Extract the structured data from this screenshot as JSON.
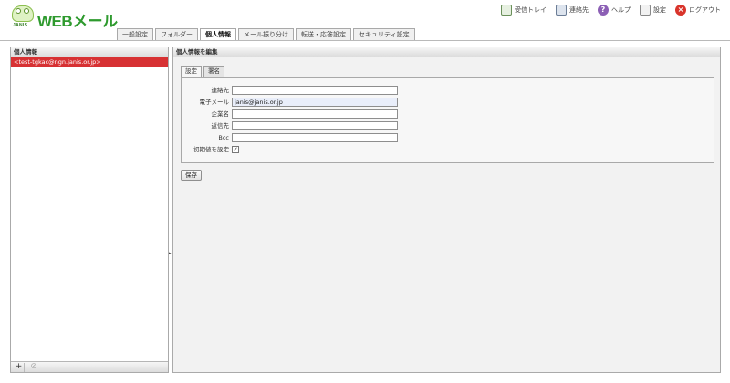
{
  "header": {
    "brand": "JANIS",
    "app_title": "WEBメール",
    "links": [
      {
        "icon": "inbox-tray-icon",
        "label": "受信トレイ"
      },
      {
        "icon": "address-book-icon",
        "label": "連絡先"
      },
      {
        "icon": "help-icon",
        "label": "ヘルプ"
      },
      {
        "icon": "settings-icon",
        "label": "設定"
      },
      {
        "icon": "logout-icon",
        "label": "ログアウト"
      }
    ]
  },
  "tabs": [
    {
      "label": "一般設定"
    },
    {
      "label": "フォルダー"
    },
    {
      "label": "個人情報",
      "active": true
    },
    {
      "label": "メール振り分け"
    },
    {
      "label": "転送・応答設定"
    },
    {
      "label": "セキュリティ設定"
    }
  ],
  "left_panel": {
    "title": "個人情報",
    "items": [
      {
        "label": "<test-tgkac@ngn.janis.or.jp>",
        "selected": true
      }
    ],
    "footer": {
      "add_label": "+",
      "disable_label": "⊘"
    }
  },
  "right_panel": {
    "title": "個人情報を編集",
    "subtabs": [
      {
        "label": "設定",
        "active": true
      },
      {
        "label": "署名"
      }
    ],
    "fields": {
      "name": {
        "label": "連絡先",
        "value": ""
      },
      "email": {
        "label": "電子メール",
        "value": "janis@janis.or.jp"
      },
      "company": {
        "label": "企業名",
        "value": ""
      },
      "reply_to": {
        "label": "返信先",
        "value": ""
      },
      "bcc": {
        "label": "Bcc",
        "value": ""
      },
      "default": {
        "label": "初期値を設定",
        "checked": true,
        "mark": "✓"
      }
    },
    "save_label": "保存"
  },
  "colors": {
    "accent_title": "#2e9a2e",
    "selected_row": "#d73133",
    "panel_bg": "#f2f2f2"
  }
}
